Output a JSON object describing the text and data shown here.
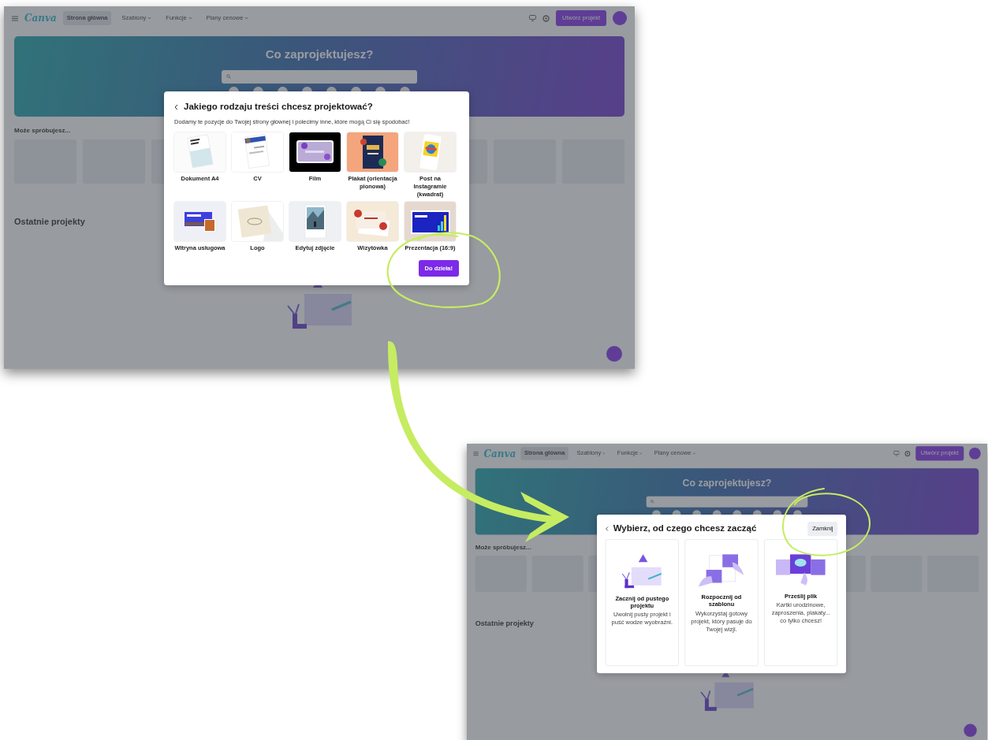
{
  "screens": [
    {
      "nav": {
        "logo": "Canva",
        "items": [
          {
            "label": "Strona główna",
            "selected": true,
            "dropdown": false
          },
          {
            "label": "Szablony",
            "selected": false,
            "dropdown": true
          },
          {
            "label": "Funkcje",
            "selected": false,
            "dropdown": true
          },
          {
            "label": "Plany cenowe",
            "selected": false,
            "dropdown": true
          }
        ],
        "create_button": "Utwórz projekt"
      },
      "banner": {
        "title": "Co zaprojektujesz?"
      },
      "suggestions_title": "Może spróbujesz...",
      "recent_title": "Ostatnie projekty",
      "dialog": {
        "kind": "content_types",
        "title": "Jakiego rodzaju treści chcesz projektować?",
        "subtitle": "Dodamy te pozycje do Twojej strony głównej i polecimy inne, które mogą Ci się spodobać!",
        "tiles": [
          {
            "label": "Dokument A4"
          },
          {
            "label": "CV"
          },
          {
            "label": "Film"
          },
          {
            "label": "Plakat (orientacja pionowa)"
          },
          {
            "label": "Post na Instagramie (kwadrat)"
          },
          {
            "label": "Witryna usługowa"
          },
          {
            "label": "Logo"
          },
          {
            "label": "Edytuj zdjęcie"
          },
          {
            "label": "Wizytówka"
          },
          {
            "label": "Prezentacja (16:9)"
          }
        ],
        "next_button": "Do dzieła!"
      }
    },
    {
      "nav": {
        "logo": "Canva",
        "items": [
          {
            "label": "Strona główna",
            "selected": true,
            "dropdown": false
          },
          {
            "label": "Szablony",
            "selected": false,
            "dropdown": true
          },
          {
            "label": "Funkcje",
            "selected": false,
            "dropdown": true
          },
          {
            "label": "Plany cenowe",
            "selected": false,
            "dropdown": true
          }
        ],
        "create_button": "Utwórz projekt"
      },
      "banner": {
        "title": "Co zaprojektujesz?"
      },
      "suggestions_title": "Może spróbujesz...",
      "recent_title": "Ostatnie projekty",
      "dialog": {
        "kind": "start_options",
        "title": "Wybierz, od czego chcesz zacząć",
        "close_button": "Zamknij",
        "options": [
          {
            "kind": "blank",
            "title": "Zacznij od pustego projektu",
            "description": "Uwolnij pusty projekt i puść wodze wyobraźni."
          },
          {
            "kind": "template",
            "title": "Rozpocznij od szablonu",
            "description": "Wykorzystaj gotowy projekt, który pasuje do Twojej wizji."
          },
          {
            "kind": "upload",
            "title": "Prześlij plik",
            "description": "Kartki urodzinowe, zaproszenia, plakaty... co tylko chcesz!"
          }
        ]
      }
    }
  ]
}
